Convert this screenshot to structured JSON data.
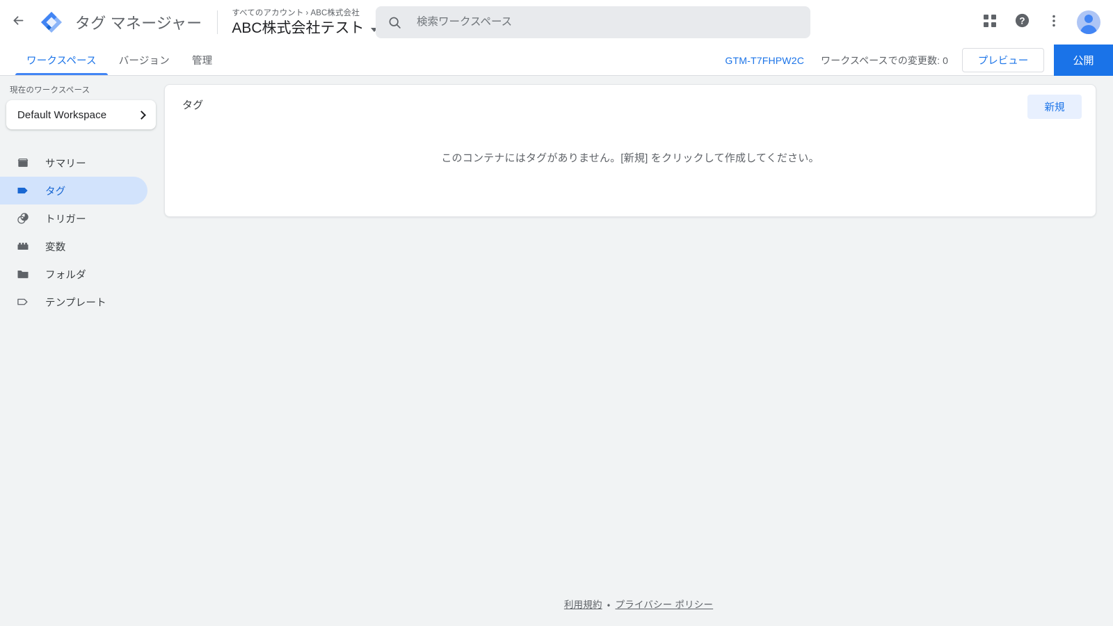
{
  "app": {
    "product_name": "タグ マネージャー",
    "logo_icon": "tag-manager-logo-icon",
    "back_icon": "back-arrow-icon"
  },
  "header": {
    "breadcrumb_root": "すべてのアカウント",
    "breadcrumb_separator": "›",
    "breadcrumb_account": "ABC株式会社",
    "container_name": "ABC株式会社テスト",
    "container_caret_icon": "chevron-down-icon"
  },
  "search": {
    "placeholder": "検索ワークスペース",
    "value": "",
    "icon": "search-icon"
  },
  "header_actions": {
    "apps_icon": "google-apps-grid-icon",
    "help_icon": "help-question-icon",
    "more_icon": "more-vert-icon",
    "avatar_icon": "user-avatar-icon"
  },
  "tabbar": {
    "tabs": [
      {
        "label": "ワークスペース",
        "active": true
      },
      {
        "label": "バージョン",
        "active": false
      },
      {
        "label": "管理",
        "active": false
      }
    ],
    "container_id": "GTM-T7FHPW2C",
    "changes_label": "ワークスペースでの変更数: 0",
    "preview_label": "プレビュー",
    "publish_label": "公開",
    "accent_color": "#1a73e8",
    "tab_underline_color": "#4285f4"
  },
  "sidebar": {
    "current_workspace_label": "現在のワークスペース",
    "workspace_name": "Default Workspace",
    "workspace_chevron_icon": "chevron-right-icon",
    "items": [
      {
        "label": "サマリー",
        "icon": "summary-box-icon",
        "active": false
      },
      {
        "label": "タグ",
        "icon": "tag-icon",
        "active": true
      },
      {
        "label": "トリガー",
        "icon": "trigger-circles-icon",
        "active": false
      },
      {
        "label": "変数",
        "icon": "variable-brick-icon",
        "active": false
      },
      {
        "label": "フォルダ",
        "icon": "folder-icon",
        "active": false
      },
      {
        "label": "テンプレート",
        "icon": "template-tag-outline-icon",
        "active": false
      }
    ],
    "active_bg_color": "#d2e3fc",
    "active_text_color": "#1967d2"
  },
  "main": {
    "card_title": "タグ",
    "new_button_label": "新規",
    "empty_message": "このコンテナにはタグがありません。[新規] をクリックして作成してください。"
  },
  "footer": {
    "terms_label": "利用規約",
    "separator": "・",
    "privacy_label": "プライバシー ポリシー"
  }
}
